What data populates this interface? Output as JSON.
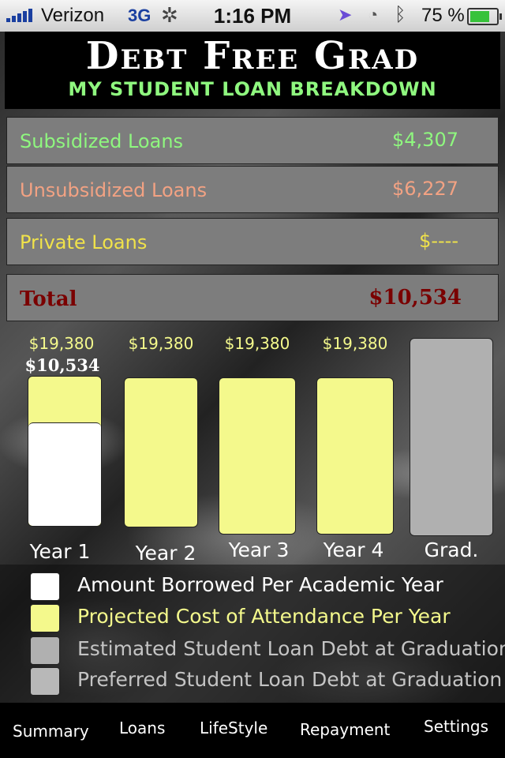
{
  "colors": {
    "subsidized": "#8ff77f",
    "unsubsidized": "#f2a283",
    "private": "#f0e24a",
    "total": "#7a0000",
    "cost_fill": "#f4f98c",
    "borrowed_fill": "#ffffff",
    "grad_fill": "#b0b0b0",
    "preferred_fill": "#b8b8b8"
  },
  "status_bar": {
    "carrier": "Verizon",
    "network": "3G",
    "time": "1:16 PM",
    "battery_percent": "75 %",
    "battery_level": 0.75,
    "icons": [
      "signal-icon",
      "activity-spinner-icon",
      "location-icon",
      "clock-icon",
      "bluetooth-icon",
      "battery-icon"
    ]
  },
  "header": {
    "title": "Debt Free Grad",
    "subtitle": "MY STUDENT LOAN BREAKDOWN"
  },
  "loans": {
    "subsidized": {
      "label": "Subsidized Loans",
      "value": "$4,307"
    },
    "unsubsidized": {
      "label": "Unsubsidized Loans",
      "value": "$6,227"
    },
    "private": {
      "label": "Private Loans",
      "value": "$----"
    },
    "total": {
      "label": "Total",
      "value": "$10,534"
    }
  },
  "chart_data": {
    "type": "bar",
    "categories": [
      "Year 1",
      "Year 2",
      "Year 3",
      "Year 4",
      "Grad."
    ],
    "cost_labels": [
      "$19,380",
      "$19,380",
      "$19,380",
      "$19,380",
      ""
    ],
    "borrowed_labels": [
      "$10,534",
      "",
      "",
      "",
      ""
    ],
    "series": [
      {
        "name": "Projected Cost of Attendance Per Year",
        "values": [
          19380,
          19380,
          19380,
          19380,
          null
        ]
      },
      {
        "name": "Amount Borrowed Per Academic Year",
        "values": [
          10534,
          0,
          0,
          0,
          null
        ]
      }
    ],
    "ylim": [
      0,
      19380
    ]
  },
  "legend": {
    "items": [
      {
        "label": "Amount Borrowed Per Academic Year",
        "color": "#ffffff",
        "text_color": "#ffffff"
      },
      {
        "label": "Projected Cost of Attendance Per Year",
        "color": "#f4f98c",
        "text_color": "#f4f98c"
      },
      {
        "label": "Estimated Student Loan Debt at Graduation",
        "color": "#b0b0b0",
        "text_color": "#c4c4c4"
      },
      {
        "label": "Preferred Student Loan Debt at Graduation",
        "color": "#b8b8b8",
        "text_color": "#c4c4c4"
      }
    ]
  },
  "tabs": [
    {
      "label": "Summary"
    },
    {
      "label": "Loans"
    },
    {
      "label": "LifeStyle"
    },
    {
      "label": "Repayment"
    },
    {
      "label": "Settings"
    }
  ]
}
